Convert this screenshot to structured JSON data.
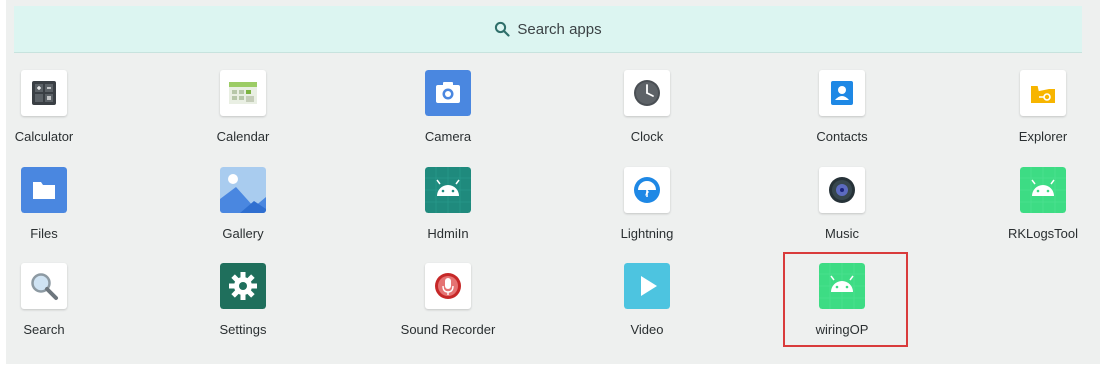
{
  "search": {
    "label": "Search apps",
    "icon": "search-icon"
  },
  "apps": [
    {
      "label": "Calculator",
      "icon": "calculator-icon"
    },
    {
      "label": "Calendar",
      "icon": "calendar-icon"
    },
    {
      "label": "Camera",
      "icon": "camera-icon"
    },
    {
      "label": "Clock",
      "icon": "clock-icon"
    },
    {
      "label": "Contacts",
      "icon": "contacts-icon"
    },
    {
      "label": "Explorer",
      "icon": "folder-icon"
    },
    {
      "label": "Files",
      "icon": "files-icon"
    },
    {
      "label": "Gallery",
      "icon": "gallery-icon"
    },
    {
      "label": "HdmiIn",
      "icon": "android-icon"
    },
    {
      "label": "Lightning",
      "icon": "lightning-icon"
    },
    {
      "label": "Music",
      "icon": "music-icon"
    },
    {
      "label": "RKLogsTool",
      "icon": "android-icon"
    },
    {
      "label": "Search",
      "icon": "magnifier-icon"
    },
    {
      "label": "Settings",
      "icon": "gear-icon"
    },
    {
      "label": "Sound Recorder",
      "icon": "microphone-icon"
    },
    {
      "label": "Video",
      "icon": "play-icon"
    },
    {
      "label": "wiringOP",
      "icon": "android-icon"
    }
  ],
  "colors": {
    "highlight": "#d93b3b",
    "search_bg": "#dcf5f1",
    "drawer_bg": "#eef0ef"
  }
}
